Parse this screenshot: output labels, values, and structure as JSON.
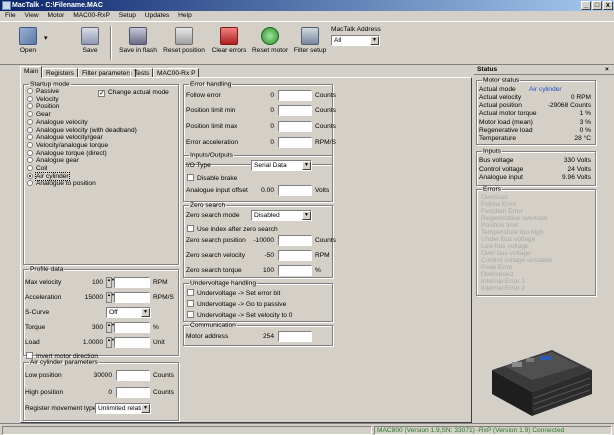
{
  "window": {
    "title": "MacTalk - C:\\Filename.MAC",
    "minimize": "_",
    "maximize": "□",
    "close": "x"
  },
  "menu": [
    "File",
    "View",
    "Motor",
    "MAC00-RxP",
    "Setup",
    "Updates",
    "Help"
  ],
  "toolbar": {
    "open": "Open",
    "save": "Save",
    "save_flash": "Save in flash",
    "reset_position": "Reset position",
    "clear_errors": "Clear errors",
    "reset_motor": "Reset motor",
    "filter_setup": "Filter setup",
    "address_label": "MacTalk Address",
    "address_value": "All"
  },
  "tabs": [
    "Main",
    "Registers",
    "Filter parameters",
    "Tests",
    "MAC00-Rx P"
  ],
  "startup": {
    "title": "Startup mode",
    "change_actual_mode": "Change actual mode",
    "modes": [
      "Passive",
      "Velocity",
      "Position",
      "Gear",
      "Analogue velocity",
      "Analogue velocity (with deadband)",
      "Analogue velocity/gear",
      "Velocity/analogue torque",
      "Analogue torque (direct)",
      "Analogue gear",
      "Coil",
      "Air cylinder",
      "Analogue to position"
    ],
    "selected": "Air cylinder"
  },
  "profile": {
    "title": "Profile data",
    "max_velocity": {
      "label": "Max velocity",
      "value": "100",
      "unit": "RPM"
    },
    "acceleration": {
      "label": "Acceleration",
      "value": "15000",
      "unit": "RPM/S"
    },
    "s_curve": {
      "label": "S-Curve",
      "value": "Off"
    },
    "torque": {
      "label": "Torque",
      "value": "300",
      "unit": "%"
    },
    "load": {
      "label": "Load",
      "value": "1.0000",
      "unit": "Unit"
    },
    "invert": "Invert motor direction"
  },
  "aircyl": {
    "title": "Air cylinder parameters",
    "low": {
      "label": "Low position",
      "value": "30000",
      "unit": "Counts"
    },
    "high": {
      "label": "High position",
      "value": "0",
      "unit": "Counts"
    },
    "reg_label": "Register movement type",
    "reg_value": "Unlimited relative"
  },
  "errhandling": {
    "title": "Error handling",
    "follow": {
      "label": "Follow error",
      "value": "0",
      "unit": "Counts"
    },
    "pos_min": {
      "label": "Position limit min",
      "value": "0",
      "unit": "Counts"
    },
    "pos_max": {
      "label": "Position limit max",
      "value": "0",
      "unit": "Counts"
    },
    "err_acc": {
      "label": "Error acceleration",
      "value": "0",
      "unit": "RPM/S"
    }
  },
  "io": {
    "title": "Inputs/Outputs",
    "io_type_label": "I/O Type",
    "io_type_value": "Serial Data",
    "disable_brake": "Disable brake",
    "analogue_offset_label": "Analogue input offset",
    "analogue_offset_value": "0.00",
    "analogue_offset_unit": "Volts"
  },
  "zero": {
    "title": "Zero search",
    "mode_label": "Zero search mode",
    "mode_value": "Disabled",
    "use_index": "Use index after zero search",
    "position": {
      "label": "Zero search position",
      "value": "-10000",
      "unit": "Counts"
    },
    "velocity": {
      "label": "Zero search velocity",
      "value": "-50",
      "unit": "RPM"
    },
    "torque": {
      "label": "Zero search torque",
      "value": "100",
      "unit": "%"
    }
  },
  "undervoltage": {
    "title": "Undervoltage handling",
    "opt1": "Undervoltage -> Set error bit",
    "opt2": "Undervoltage -> Go to passive",
    "opt3": "Undervoltage -> Set velocity to 0"
  },
  "comm": {
    "title": "Communication",
    "address_label": "Motor address",
    "address_value": "254"
  },
  "status": {
    "title": "Status",
    "motor_status": "Motor status",
    "actual_mode_label": "Actual mode",
    "actual_mode_value": "Air cylinder",
    "rows": [
      {
        "label": "Actual velocity",
        "value": "0 RPM"
      },
      {
        "label": "Actual position",
        "value": "-29068 Counts"
      },
      {
        "label": "Actual motor torque",
        "value": "1 %"
      },
      {
        "label": "Motor load (mean)",
        "value": "3 %"
      },
      {
        "label": "Regenerative load",
        "value": "0 %"
      },
      {
        "label": "Temperature",
        "value": "28 °C"
      }
    ],
    "inputs_title": "Inputs",
    "inputs": [
      {
        "label": "Bus voltage",
        "value": "330 Volts"
      },
      {
        "label": "Control voltage",
        "value": "24 Volts"
      },
      {
        "label": "Analogue input",
        "value": "9.96 Volts"
      }
    ],
    "errors_title": "Errors",
    "errors": [
      "Overload",
      "Follow Error",
      "Function Error",
      "Regenerative overload",
      "Position limit",
      "Temperature too high",
      "Under Bus voltage",
      "Low bus voltage",
      "Over bus voltage",
      "Control voltage unstable",
      "Peak Error",
      "Overspeed",
      "Internal Error 1",
      "Internal Error 2"
    ]
  },
  "statusbar": {
    "info": "MAC800 (Version 1.9,SN: 33071) -RxP (Version 1.9) Connected"
  },
  "colors": {
    "title_start": "#0a246a",
    "title_end": "#a6caf0",
    "accent_text": "#2050c0",
    "status_green": "#2a7a2a"
  }
}
